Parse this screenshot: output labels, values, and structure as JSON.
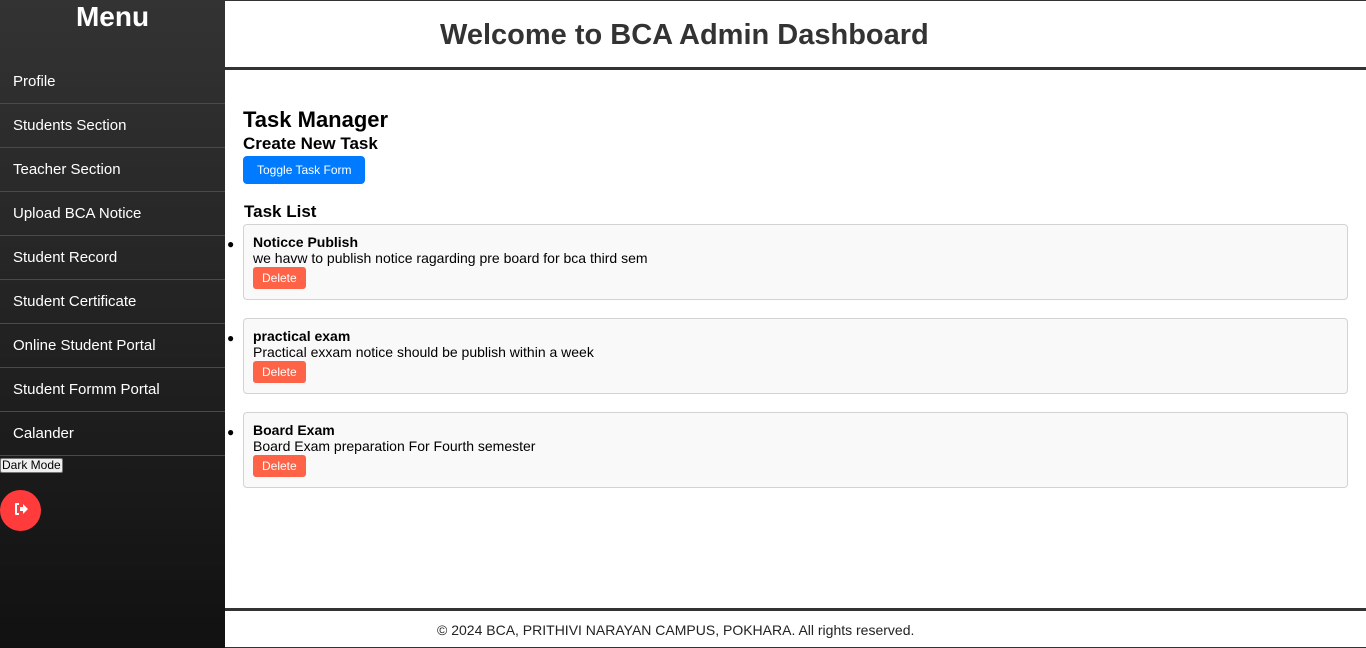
{
  "sidebar": {
    "title": "Menu",
    "items": [
      {
        "label": "Profile"
      },
      {
        "label": "Students Section"
      },
      {
        "label": "Teacher Section"
      },
      {
        "label": "Upload BCA Notice"
      },
      {
        "label": "Student Record"
      },
      {
        "label": "Student Certificate"
      },
      {
        "label": "Online Student Portal"
      },
      {
        "label": "Student Formm Portal"
      },
      {
        "label": "Calander"
      }
    ],
    "dark_mode_label": "Dark Mode",
    "logout_icon": "logout-icon"
  },
  "header": {
    "title": "Welcome to BCA Admin Dashboard"
  },
  "task_manager": {
    "title": "Task Manager",
    "create_title": "Create New Task",
    "toggle_label": "Toggle Task Form",
    "list_title": "Task List",
    "tasks": [
      {
        "title": "Noticce Publish",
        "description": "we havw to publish notice ragarding pre board for bca third sem",
        "delete_label": "Delete"
      },
      {
        "title": "practical exam",
        "description": "Practical exxam notice should be publish within a week",
        "delete_label": "Delete"
      },
      {
        "title": "Board Exam",
        "description": "Board Exam preparation For Fourth semester",
        "delete_label": "Delete"
      }
    ]
  },
  "footer": {
    "text": "© 2024 BCA, PRITHIVI NARAYAN CAMPUS, POKHARA. All rights reserved."
  },
  "colors": {
    "primary_button": "#007bff",
    "delete_button": "#ff6347",
    "logout_button": "#ff3b3b"
  }
}
